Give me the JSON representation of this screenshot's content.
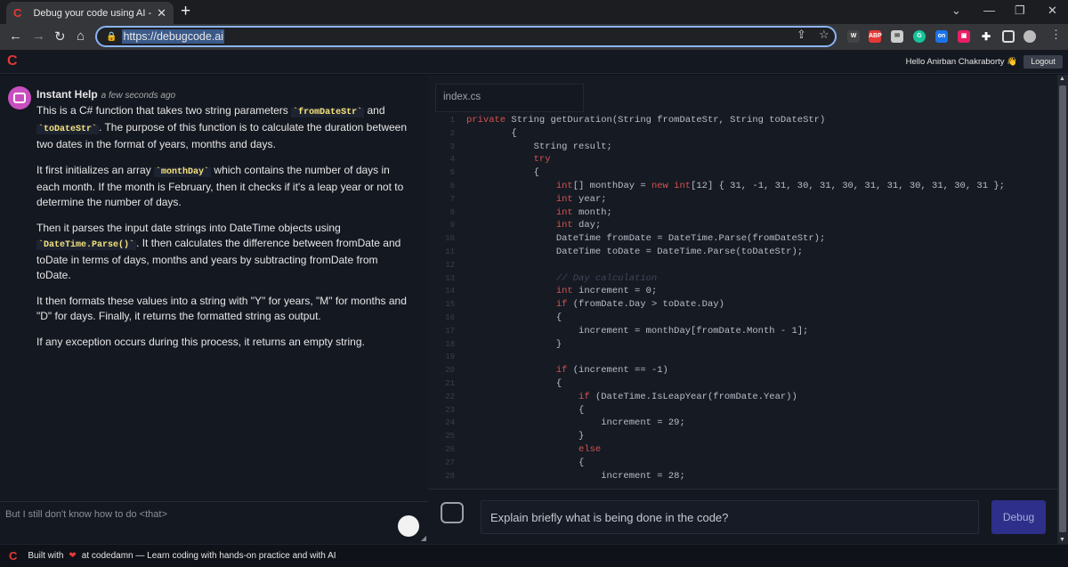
{
  "browser": {
    "tab_title": "Debug your code using AI - Debu",
    "tab_favicon": "C",
    "url": "https://debugcode.ai"
  },
  "header": {
    "logo": "C",
    "greeting": "Hello Anirban Chakraborty 👋",
    "logout_label": "Logout"
  },
  "chat": {
    "sender": "Instant Help",
    "time": "a few seconds ago",
    "p1_a": "This is a C# function that takes two string parameters ",
    "p1_code1": "`fromDateStr`",
    "p1_b": " and ",
    "p1_code2": "`toDateStr`",
    "p1_c": ". The purpose of this function is to calculate the duration between two dates in the format of years, months and days.",
    "p2_a": "It first initializes an array ",
    "p2_code": "`monthDay`",
    "p2_b": " which contains the number of days in each month. If the month is February, then it checks if it's a leap year or not to determine the number of days.",
    "p3_a": "Then it parses the input date strings into DateTime objects using ",
    "p3_code": "`DateTime.Parse()`",
    "p3_b": ". It then calculates the difference between fromDate and toDate in terms of days, months and years by subtracting fromDate from toDate.",
    "p4": "It then formats these values into a string with \"Y\" for years, \"M\" for months and \"D\" for days. Finally, it returns the formatted string as output.",
    "p5": "If any exception occurs during this process, it returns an empty string.",
    "composer_placeholder": "But I still don't know how to do <that>"
  },
  "editor": {
    "file_name": "index.cs",
    "lines": [
      {
        "n": "1",
        "code": "private String getDuration(String fromDateStr, String toDateStr)"
      },
      {
        "n": "2",
        "code": "        {"
      },
      {
        "n": "3",
        "code": "            String result;"
      },
      {
        "n": "4",
        "code": "            try"
      },
      {
        "n": "5",
        "code": "            {"
      },
      {
        "n": "6",
        "code": "                int[] monthDay = new int[12] { 31, -1, 31, 30, 31, 30, 31, 31, 30, 31, 30, 31 };"
      },
      {
        "n": "7",
        "code": "                int year;"
      },
      {
        "n": "8",
        "code": "                int month;"
      },
      {
        "n": "9",
        "code": "                int day;"
      },
      {
        "n": "10",
        "code": "                DateTime fromDate = DateTime.Parse(fromDateStr);"
      },
      {
        "n": "11",
        "code": "                DateTime toDate = DateTime.Parse(toDateStr);"
      },
      {
        "n": "12",
        "code": ""
      },
      {
        "n": "13",
        "code": "                // Day calculation"
      },
      {
        "n": "14",
        "code": "                int increment = 0;"
      },
      {
        "n": "15",
        "code": "                if (fromDate.Day > toDate.Day)"
      },
      {
        "n": "16",
        "code": "                {"
      },
      {
        "n": "17",
        "code": "                    increment = monthDay[fromDate.Month - 1];"
      },
      {
        "n": "18",
        "code": "                }"
      },
      {
        "n": "19",
        "code": ""
      },
      {
        "n": "20",
        "code": "                if (increment == -1)"
      },
      {
        "n": "21",
        "code": "                {"
      },
      {
        "n": "22",
        "code": "                    if (DateTime.IsLeapYear(fromDate.Year))"
      },
      {
        "n": "23",
        "code": "                    {"
      },
      {
        "n": "24",
        "code": "                        increment = 29;"
      },
      {
        "n": "25",
        "code": "                    }"
      },
      {
        "n": "26",
        "code": "                    else"
      },
      {
        "n": "27",
        "code": "                    {"
      },
      {
        "n": "28",
        "code": "                        increment = 28;"
      }
    ],
    "ask_placeholder": "Explain briefly what is being done in the code?",
    "debug_label": "Debug"
  },
  "footer": {
    "logo": "C",
    "built_with": "Built with",
    "heart": "❤",
    "tagline": "at codedamn — Learn coding with hands-on practice and with AI"
  },
  "colors": {
    "accent": "#e53935",
    "debug_button": "#2d2f8a",
    "keyword": "#d9534f",
    "inline_code": "#f5e27a"
  }
}
